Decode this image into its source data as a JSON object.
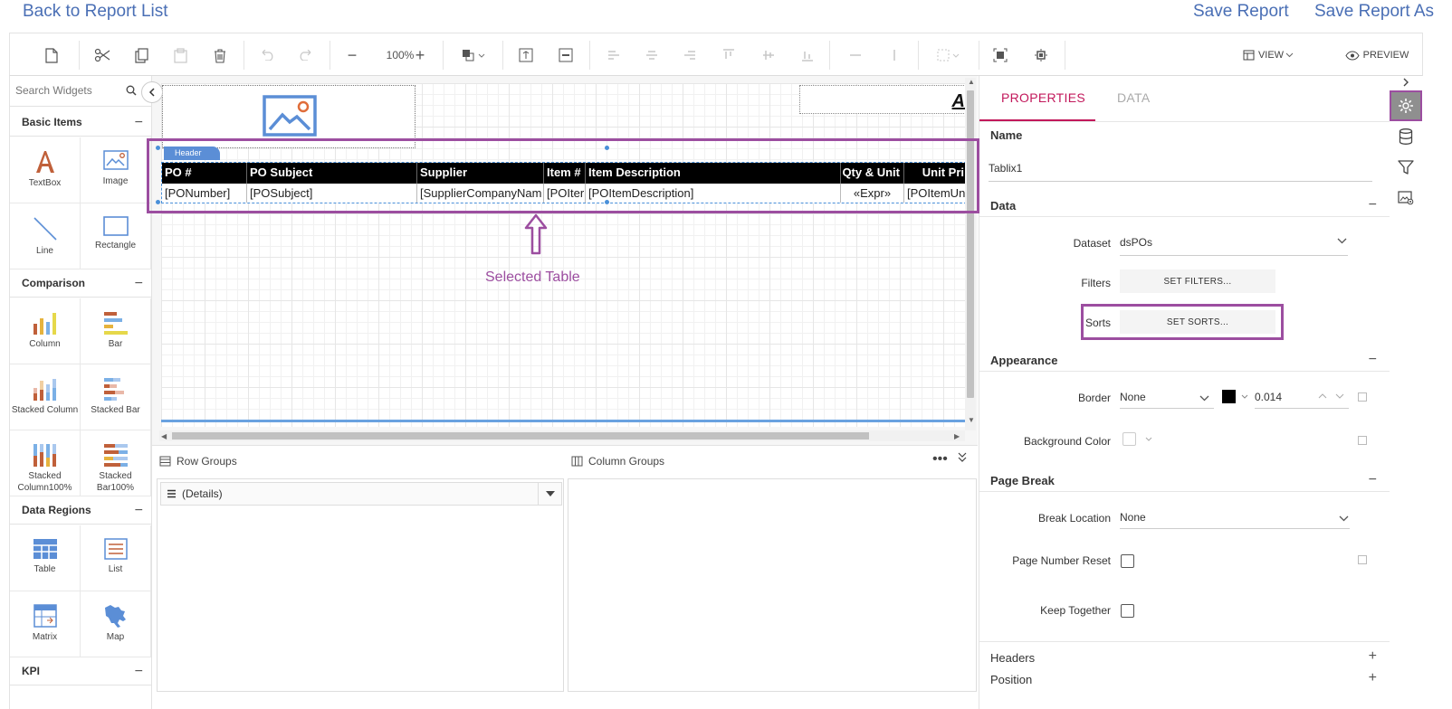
{
  "header": {
    "back_link": "Back to Report List",
    "save_report": "Save Report",
    "save_report_as": "Save Report As"
  },
  "toolbar": {
    "zoom": "100%",
    "view_label": "VIEW",
    "preview_label": "PREVIEW"
  },
  "widgets": {
    "search_placeholder": "Search Widgets",
    "sections": [
      {
        "title": "Basic Items",
        "items": [
          "TextBox",
          "Image",
          "Line",
          "Rectangle"
        ]
      },
      {
        "title": "Comparison",
        "items": [
          "Column",
          "Bar",
          "Stacked Column",
          "Stacked Bar",
          "Stacked Column100%",
          "Stacked Bar100%"
        ]
      },
      {
        "title": "Data Regions",
        "items": [
          "Table",
          "List",
          "Matrix",
          "Map"
        ]
      },
      {
        "title": "KPI",
        "items": []
      }
    ]
  },
  "canvas": {
    "header_tag": "Header",
    "title_fragment": "A",
    "table": {
      "columns": [
        "PO #",
        "PO Subject",
        "Supplier",
        "Item #",
        "Item Description",
        "Qty & Unit",
        "Unit Pri"
      ],
      "row": [
        "[PONumber]",
        "[POSubject]",
        "[SupplierCompanyNam",
        "[POIter",
        "[POItemDescription]",
        "«Expr»",
        "[POItemUn"
      ]
    }
  },
  "annotation": {
    "selected_table": "Selected Table"
  },
  "groups": {
    "row_groups": "Row Groups",
    "column_groups": "Column Groups",
    "details": "(Details)"
  },
  "properties": {
    "tabs": [
      "PROPERTIES",
      "DATA"
    ],
    "name_label": "Name",
    "name_value": "Tablix1",
    "data_section": "Data",
    "dataset_label": "Dataset",
    "dataset_value": "dsPOs",
    "filters_label": "Filters",
    "filters_button": "SET FILTERS...",
    "sorts_label": "Sorts",
    "sorts_button": "SET SORTS...",
    "appearance_section": "Appearance",
    "border_label": "Border",
    "border_value": "None",
    "border_width": "0.014",
    "border_color": "#000000",
    "bg_color_label": "Background Color",
    "page_break_section": "Page Break",
    "break_location_label": "Break Location",
    "break_location_value": "None",
    "page_number_reset_label": "Page Number Reset",
    "keep_together_label": "Keep Together",
    "headers_section": "Headers",
    "position_section": "Position"
  },
  "colors": {
    "accent": "#c2185b",
    "annotation": "#9c4ea0",
    "link": "#4a6fb5"
  }
}
